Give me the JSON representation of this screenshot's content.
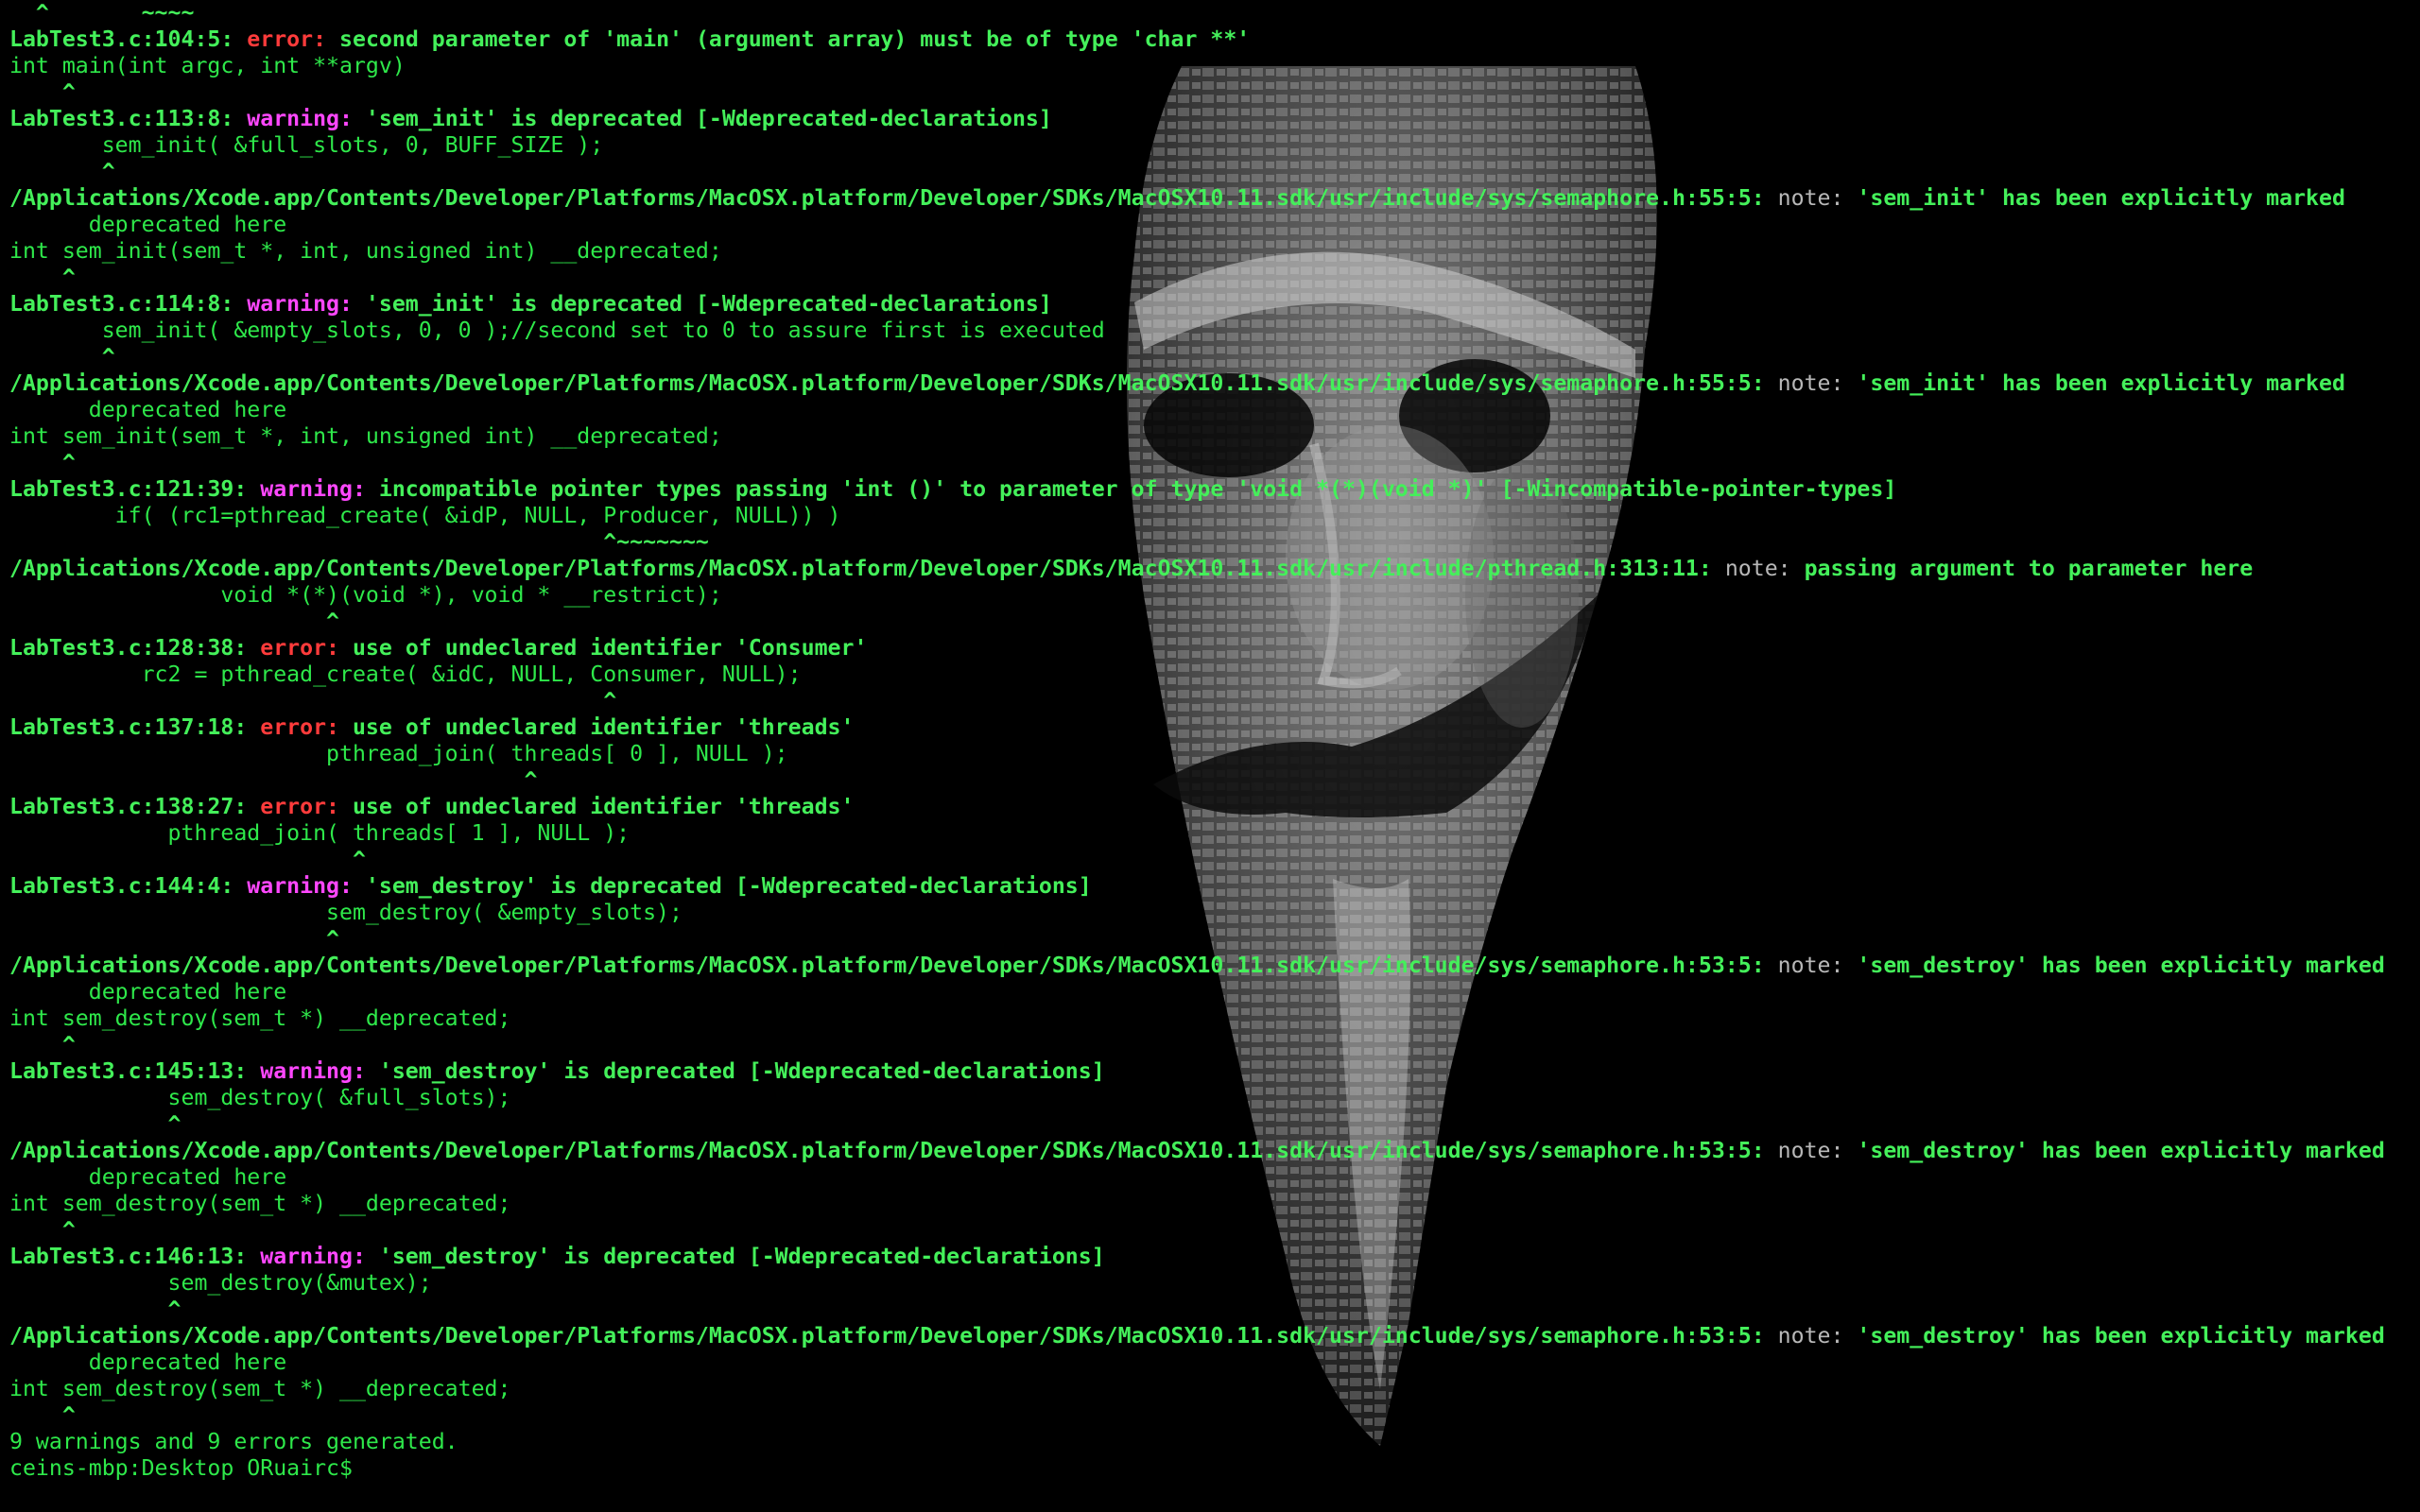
{
  "colors": {
    "background": "#000000",
    "text": "#2ee84a",
    "error_label": "#ff3b3b",
    "warning_label": "#ff47ff",
    "note_label": "#b8b8b8"
  },
  "wallpaper": {
    "icon": "anonymous-mask-text-art"
  },
  "lines": [
    {
      "type": "code",
      "text": "  ^       ~~~~"
    },
    {
      "type": "diag",
      "loc": "LabTest3.c:104:5:",
      "kind": "error",
      "label": "error:",
      "msg": " second parameter of 'main' (argument array) must be of type 'char **'"
    },
    {
      "type": "code",
      "text": "int main(int argc, int **argv)"
    },
    {
      "type": "code",
      "text": "    ^"
    },
    {
      "type": "diag",
      "loc": "LabTest3.c:113:8:",
      "kind": "warning",
      "label": "warning:",
      "msg": " 'sem_init' is deprecated [-Wdeprecated-declarations]"
    },
    {
      "type": "code",
      "text": "       sem_init( &full_slots, 0, BUFF_SIZE );"
    },
    {
      "type": "code",
      "text": "       ^"
    },
    {
      "type": "diag",
      "loc": "/Applications/Xcode.app/Contents/Developer/Platforms/MacOSX.platform/Developer/SDKs/MacOSX10.11.sdk/usr/include/sys/semaphore.h:55:5:",
      "kind": "note",
      "label": " note:",
      "msg": " 'sem_init' has been explicitly marked"
    },
    {
      "type": "code",
      "text": "      deprecated here"
    },
    {
      "type": "code",
      "text": "int sem_init(sem_t *, int, unsigned int) __deprecated;"
    },
    {
      "type": "code",
      "text": "    ^"
    },
    {
      "type": "diag",
      "loc": "LabTest3.c:114:8:",
      "kind": "warning",
      "label": "warning:",
      "msg": " 'sem_init' is deprecated [-Wdeprecated-declarations]"
    },
    {
      "type": "code",
      "text": "       sem_init( &empty_slots, 0, 0 );//second set to 0 to assure first is executed"
    },
    {
      "type": "code",
      "text": "       ^"
    },
    {
      "type": "diag",
      "loc": "/Applications/Xcode.app/Contents/Developer/Platforms/MacOSX.platform/Developer/SDKs/MacOSX10.11.sdk/usr/include/sys/semaphore.h:55:5:",
      "kind": "note",
      "label": " note:",
      "msg": " 'sem_init' has been explicitly marked"
    },
    {
      "type": "code",
      "text": "      deprecated here"
    },
    {
      "type": "code",
      "text": "int sem_init(sem_t *, int, unsigned int) __deprecated;"
    },
    {
      "type": "code",
      "text": "    ^"
    },
    {
      "type": "diag",
      "loc": "LabTest3.c:121:39:",
      "kind": "warning",
      "label": "warning:",
      "msg": " incompatible pointer types passing 'int ()' to parameter of type 'void *(*)(void *)' [-Wincompatible-pointer-types]"
    },
    {
      "type": "code",
      "text": "        if( (rc1=pthread_create( &idP, NULL, Producer, NULL)) )"
    },
    {
      "type": "code",
      "text": "                                             ^~~~~~~~"
    },
    {
      "type": "diag",
      "loc": "/Applications/Xcode.app/Contents/Developer/Platforms/MacOSX.platform/Developer/SDKs/MacOSX10.11.sdk/usr/include/pthread.h:313:11:",
      "kind": "note",
      "label": " note:",
      "msg": " passing argument to parameter here"
    },
    {
      "type": "code",
      "text": "                void *(*)(void *), void * __restrict);"
    },
    {
      "type": "code",
      "text": "                        ^"
    },
    {
      "type": "diag",
      "loc": "LabTest3.c:128:38:",
      "kind": "error",
      "label": "error:",
      "msg": " use of undeclared identifier 'Consumer'"
    },
    {
      "type": "code",
      "text": "          rc2 = pthread_create( &idC, NULL, Consumer, NULL);"
    },
    {
      "type": "code",
      "text": "                                             ^"
    },
    {
      "type": "diag",
      "loc": "LabTest3.c:137:18:",
      "kind": "error",
      "label": "error:",
      "msg": " use of undeclared identifier 'threads'"
    },
    {
      "type": "code",
      "text": "                        pthread_join( threads[ 0 ], NULL );"
    },
    {
      "type": "code",
      "text": "                                       ^"
    },
    {
      "type": "diag",
      "loc": "LabTest3.c:138:27:",
      "kind": "error",
      "label": "error:",
      "msg": " use of undeclared identifier 'threads'"
    },
    {
      "type": "code",
      "text": "            pthread_join( threads[ 1 ], NULL );"
    },
    {
      "type": "code",
      "text": "                          ^"
    },
    {
      "type": "diag",
      "loc": "LabTest3.c:144:4:",
      "kind": "warning",
      "label": "warning:",
      "msg": " 'sem_destroy' is deprecated [-Wdeprecated-declarations]"
    },
    {
      "type": "code",
      "text": "                        sem_destroy( &empty_slots);"
    },
    {
      "type": "code",
      "text": "                        ^"
    },
    {
      "type": "diag",
      "loc": "/Applications/Xcode.app/Contents/Developer/Platforms/MacOSX.platform/Developer/SDKs/MacOSX10.11.sdk/usr/include/sys/semaphore.h:53:5:",
      "kind": "note",
      "label": " note:",
      "msg": " 'sem_destroy' has been explicitly marked"
    },
    {
      "type": "code",
      "text": "      deprecated here"
    },
    {
      "type": "code",
      "text": "int sem_destroy(sem_t *) __deprecated;"
    },
    {
      "type": "code",
      "text": "    ^"
    },
    {
      "type": "diag",
      "loc": "LabTest3.c:145:13:",
      "kind": "warning",
      "label": "warning:",
      "msg": " 'sem_destroy' is deprecated [-Wdeprecated-declarations]"
    },
    {
      "type": "code",
      "text": "            sem_destroy( &full_slots);"
    },
    {
      "type": "code",
      "text": "            ^"
    },
    {
      "type": "diag",
      "loc": "/Applications/Xcode.app/Contents/Developer/Platforms/MacOSX.platform/Developer/SDKs/MacOSX10.11.sdk/usr/include/sys/semaphore.h:53:5:",
      "kind": "note",
      "label": " note:",
      "msg": " 'sem_destroy' has been explicitly marked"
    },
    {
      "type": "code",
      "text": "      deprecated here"
    },
    {
      "type": "code",
      "text": "int sem_destroy(sem_t *) __deprecated;"
    },
    {
      "type": "code",
      "text": "    ^"
    },
    {
      "type": "diag",
      "loc": "LabTest3.c:146:13:",
      "kind": "warning",
      "label": "warning:",
      "msg": " 'sem_destroy' is deprecated [-Wdeprecated-declarations]"
    },
    {
      "type": "code",
      "text": "            sem_destroy(&mutex);"
    },
    {
      "type": "code",
      "text": "            ^"
    },
    {
      "type": "diag",
      "loc": "/Applications/Xcode.app/Contents/Developer/Platforms/MacOSX.platform/Developer/SDKs/MacOSX10.11.sdk/usr/include/sys/semaphore.h:53:5:",
      "kind": "note",
      "label": " note:",
      "msg": " 'sem_destroy' has been explicitly marked"
    },
    {
      "type": "code",
      "text": "      deprecated here"
    },
    {
      "type": "code",
      "text": "int sem_destroy(sem_t *) __deprecated;"
    },
    {
      "type": "code",
      "text": "    ^"
    },
    {
      "type": "summary",
      "text": "9 warnings and 9 errors generated."
    },
    {
      "type": "prompt",
      "text": "ceins-mbp:Desktop ORuairc$ "
    }
  ]
}
